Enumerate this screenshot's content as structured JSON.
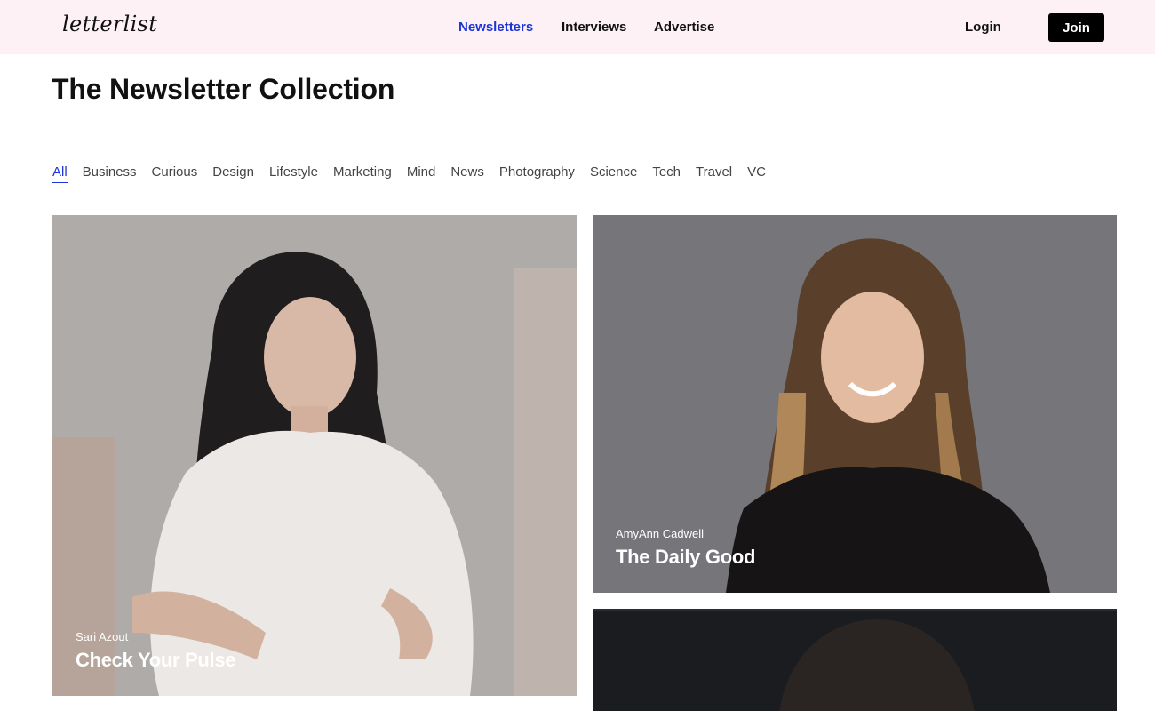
{
  "header": {
    "logo": "letterlist",
    "nav": [
      "Newsletters",
      "Interviews",
      "Advertise"
    ],
    "active_nav": "Newsletters",
    "login_label": "Login",
    "join_label": "Join"
  },
  "page": {
    "title": "The Newsletter Collection"
  },
  "categories": [
    "All",
    "Business",
    "Curious",
    "Design",
    "Lifestyle",
    "Marketing",
    "Mind",
    "News",
    "Photography",
    "Science",
    "Tech",
    "Travel",
    "VC"
  ],
  "active_category": "All",
  "cards": [
    {
      "author": "Sari Azout",
      "title": "Check Your Pulse"
    },
    {
      "author": "AmyAnn Cadwell",
      "title": "The Daily Good"
    },
    {
      "author": "",
      "title": ""
    }
  ],
  "colors": {
    "header_bg": "#fdf1f6",
    "accent": "#1b35d6",
    "join_bg": "#000000"
  },
  "icons": [
    "logo-wordmark"
  ]
}
